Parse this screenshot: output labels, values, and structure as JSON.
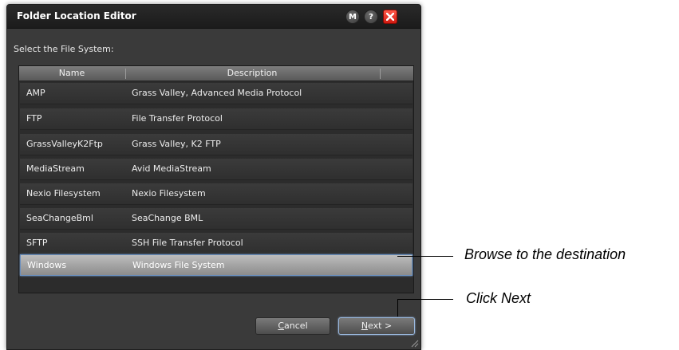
{
  "dialog": {
    "title": "Folder Location Editor",
    "buttons": {
      "m_label": "M",
      "help_label": "?",
      "close_icon": "close-icon"
    },
    "prompt": "Select the File System:",
    "columns": [
      "Name",
      "Description"
    ],
    "rows": [
      {
        "name": "AMP",
        "description": "Grass Valley, Advanced Media Protocol"
      },
      {
        "name": "FTP",
        "description": "File Transfer Protocol"
      },
      {
        "name": "GrassValleyK2Ftp",
        "description": "Grass Valley, K2 FTP"
      },
      {
        "name": "MediaStream",
        "description": "Avid MediaStream"
      },
      {
        "name": "Nexio Filesystem",
        "description": "Nexio Filesystem"
      },
      {
        "name": "SeaChangeBml",
        "description": "SeaChange BML"
      },
      {
        "name": "SFTP",
        "description": "SSH File Transfer Protocol"
      },
      {
        "name": "Windows",
        "description": "Windows File System"
      }
    ],
    "selected_row": "Windows",
    "cancel": {
      "mnemonic": "C",
      "rest": "ancel"
    },
    "next": {
      "mnemonic": "N",
      "rest": "ext >"
    }
  },
  "callouts": {
    "browse": "Browse to the destination",
    "next": "Click Next"
  },
  "colors": {
    "dialog_bg": "#3a3a3a",
    "titlebar_bg": "#1b1b1b",
    "close_red": "#e0251a",
    "selection_border": "#6a8fbf"
  }
}
